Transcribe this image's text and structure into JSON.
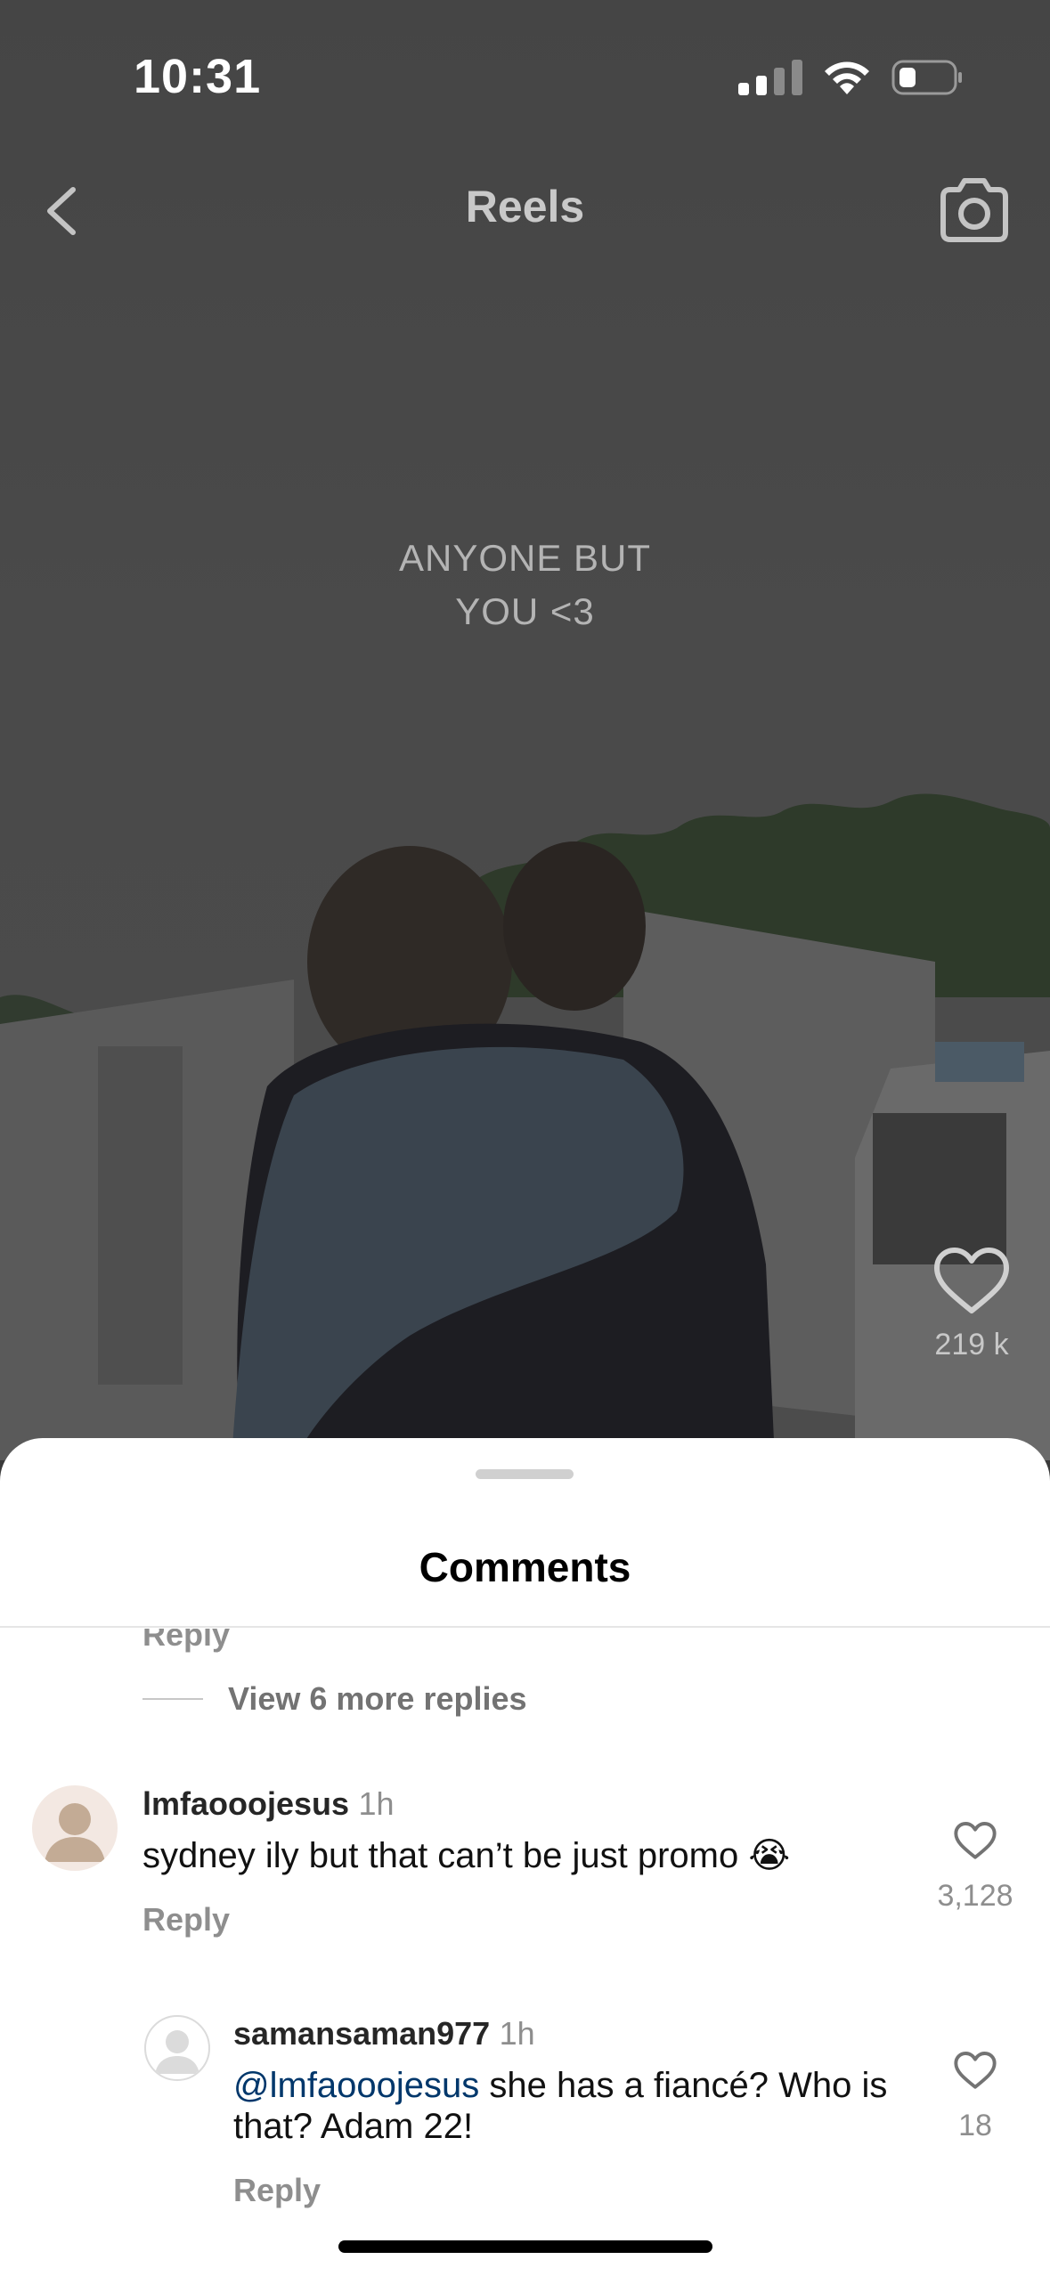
{
  "status_bar": {
    "time": "10:31"
  },
  "header": {
    "title": "Reels"
  },
  "video": {
    "overlay_text_line1": "ANYONE BUT",
    "overlay_text_line2": "YOU <3",
    "like_count": "219 k"
  },
  "comments": {
    "title": "Comments",
    "cut_reply_label": "Reply",
    "view_more_replies": "View 6 more replies",
    "items": [
      {
        "username": "lmfaooojesus",
        "time": "1h",
        "text": "sydney ily but that can’t be just promo 😭",
        "reply_label": "Reply",
        "like_count": "3,128"
      },
      {
        "username": "samansaman977",
        "time": "1h",
        "mention": "@lmfaooojesus",
        "text": " she has a fiancé? Who is that? Adam 22!",
        "reply_label": "Reply",
        "like_count": "18"
      }
    ]
  }
}
